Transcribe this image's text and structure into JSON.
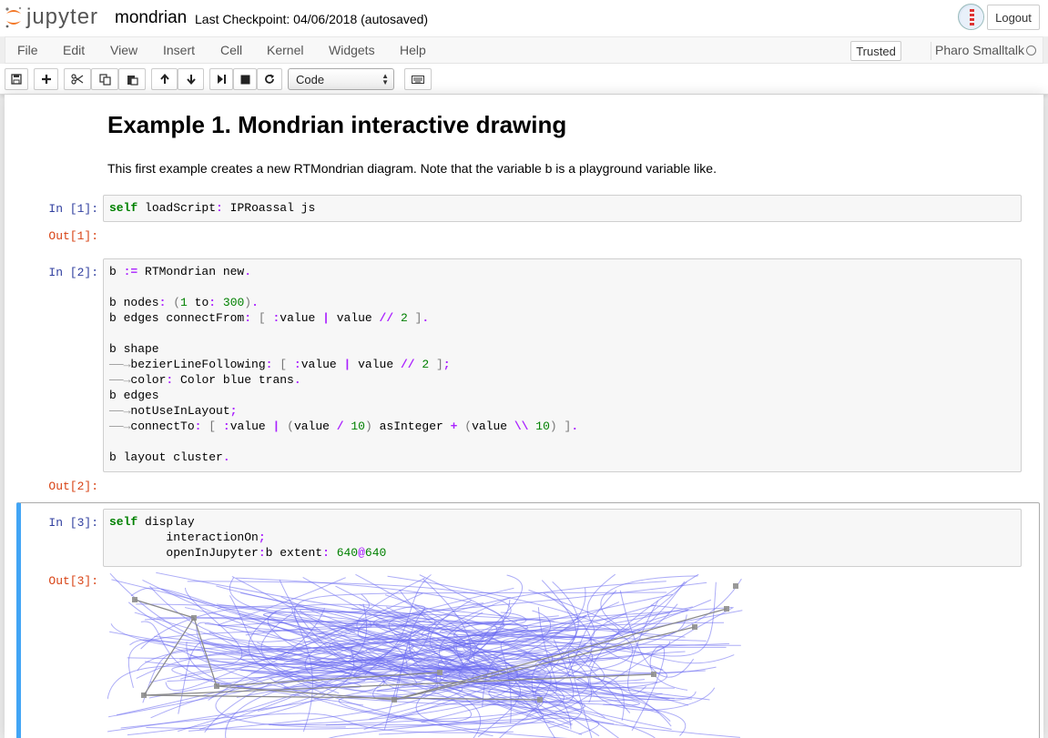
{
  "header": {
    "logo_text": "jupyter",
    "notebook_name": "mondrian",
    "checkpoint": "Last Checkpoint: 04/06/2018 (autosaved)",
    "logout_label": "Logout"
  },
  "menubar": {
    "items": [
      "File",
      "Edit",
      "View",
      "Insert",
      "Cell",
      "Kernel",
      "Widgets",
      "Help"
    ],
    "trusted_label": "Trusted",
    "kernel_name": "Pharo Smalltalk"
  },
  "toolbar": {
    "buttons": [
      "save-icon",
      "plus-icon",
      "cut-icon",
      "copy-icon",
      "paste-icon",
      "arrow-up-icon",
      "arrow-down-icon",
      "run-icon",
      "stop-icon",
      "restart-icon",
      "keyboard-icon"
    ],
    "cell_type": "Code"
  },
  "cells": {
    "md_title": "Example 1. Mondrian interactive drawing",
    "md_text": "This first example creates a new RTMondrian diagram. Note that the variable b is a playground variable like.",
    "in1": "In [1]:",
    "out1": "Out[1]:",
    "in2": "In [2]:",
    "out2": "Out[2]:",
    "in3": "In [3]:",
    "out3": "Out[3]:"
  },
  "colors": {
    "in_prompt": "#303f9f",
    "out_prompt": "#d84315",
    "selected_border": "#42a5f5",
    "curve": "#6a6af0",
    "node": "#999999"
  }
}
